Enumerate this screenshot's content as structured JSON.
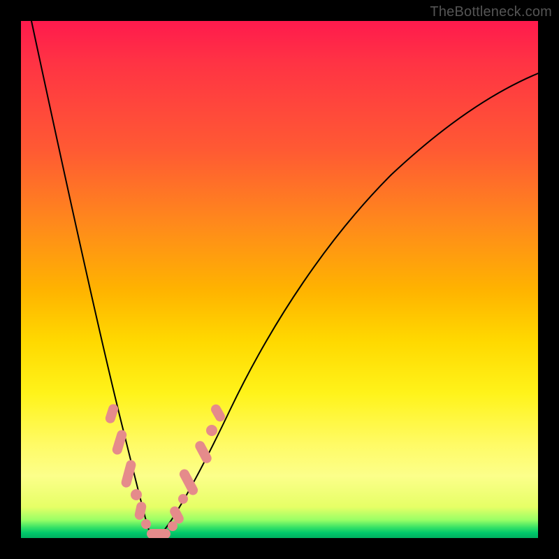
{
  "watermark": "TheBottleneck.com",
  "chart_data": {
    "type": "line",
    "title": "",
    "xlabel": "",
    "ylabel": "",
    "xlim": [
      0,
      100
    ],
    "ylim": [
      0,
      100
    ],
    "grid": false,
    "series": [
      {
        "name": "bottleneck-curve",
        "x": [
          0,
          3,
          6,
          9,
          12,
          15,
          17,
          19,
          20.5,
          22,
          23.5,
          25,
          27,
          30,
          35,
          40,
          46,
          52,
          58,
          65,
          72,
          80,
          88,
          95,
          100
        ],
        "y": [
          100,
          88,
          75,
          62,
          49,
          37,
          28,
          19,
          12,
          6,
          2,
          0,
          2,
          7,
          16,
          26,
          36,
          45,
          53,
          60,
          66,
          72,
          77,
          81,
          84
        ]
      }
    ],
    "annotations": {
      "data_markers_x_range": [
        15,
        32
      ],
      "data_markers_note": "Pink pill-shaped markers clustered near the curve minimum on both arms"
    },
    "background_gradient": {
      "top": "#ff1a4d",
      "mid_upper": "#ff8c1a",
      "mid": "#fff31a",
      "bottom": "#00b060"
    }
  }
}
